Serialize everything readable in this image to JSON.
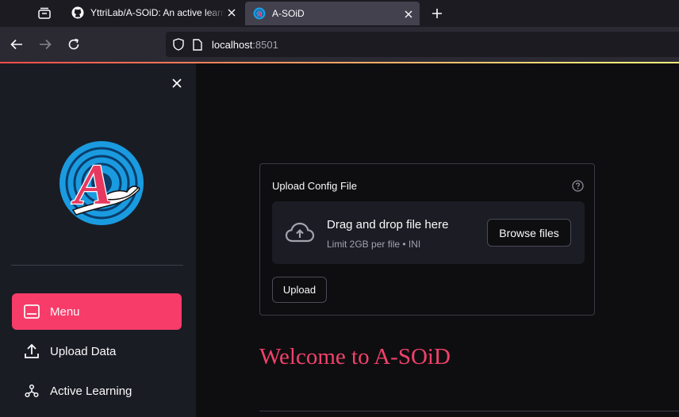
{
  "browser": {
    "tabs": [
      {
        "title": "YttriLab/A-SOiD: An active learning",
        "active": false,
        "icon": "github-icon"
      },
      {
        "title": "A-SOiD",
        "active": true,
        "icon": "asoid-favicon"
      }
    ],
    "url_host": "localhost",
    "url_port": ":8501"
  },
  "sidebar": {
    "logo_text": "A",
    "menu": [
      {
        "label": "Menu",
        "icon": "window-icon",
        "active": true
      },
      {
        "label": "Upload Data",
        "icon": "upload-icon",
        "active": false
      },
      {
        "label": "Active Learning",
        "icon": "nodes-icon",
        "active": false
      }
    ]
  },
  "main": {
    "uploader": {
      "label": "Upload Config File",
      "dropzone_title": "Drag and drop file here",
      "dropzone_limit": "Limit 2GB per file • INI",
      "browse_label": "Browse files"
    },
    "upload_button": "Upload",
    "welcome_heading": "Welcome to A-SOiD"
  },
  "colors": {
    "accent": "#f73c6a",
    "background": "#0e0e10",
    "sidebar": "#1a1c24",
    "logo_blue": "#1a9be0"
  }
}
